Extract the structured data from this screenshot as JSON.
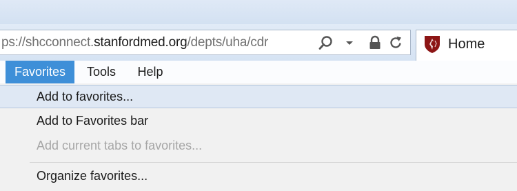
{
  "address_bar": {
    "url_prefix": "ps://shcconnect.",
    "url_domain": "stanfordmed.org",
    "url_path": "/depts/uha/cdr",
    "search_icon": "search-icon",
    "dropdown_icon": "chevron-down-icon",
    "lock_icon": "lock-icon",
    "refresh_icon": "refresh-icon"
  },
  "tab": {
    "label": "Home",
    "logo_icon": "stanford-shield-icon"
  },
  "menubar": {
    "items": [
      "Favorites",
      "Tools",
      "Help"
    ]
  },
  "favorites_menu": {
    "items": [
      {
        "label": "Add to favorites...",
        "state": "highlighted"
      },
      {
        "label": "Add to Favorites bar",
        "state": "normal"
      },
      {
        "label": "Add current tabs to favorites...",
        "state": "disabled"
      },
      {
        "label": "Organize favorites...",
        "state": "normal"
      }
    ]
  },
  "colors": {
    "menu_active_bg": "#3e8fd8",
    "item_highlight_bg": "#dfe8f4",
    "disabled_text": "#a6a6a6",
    "brand_red": "#8c1515"
  }
}
